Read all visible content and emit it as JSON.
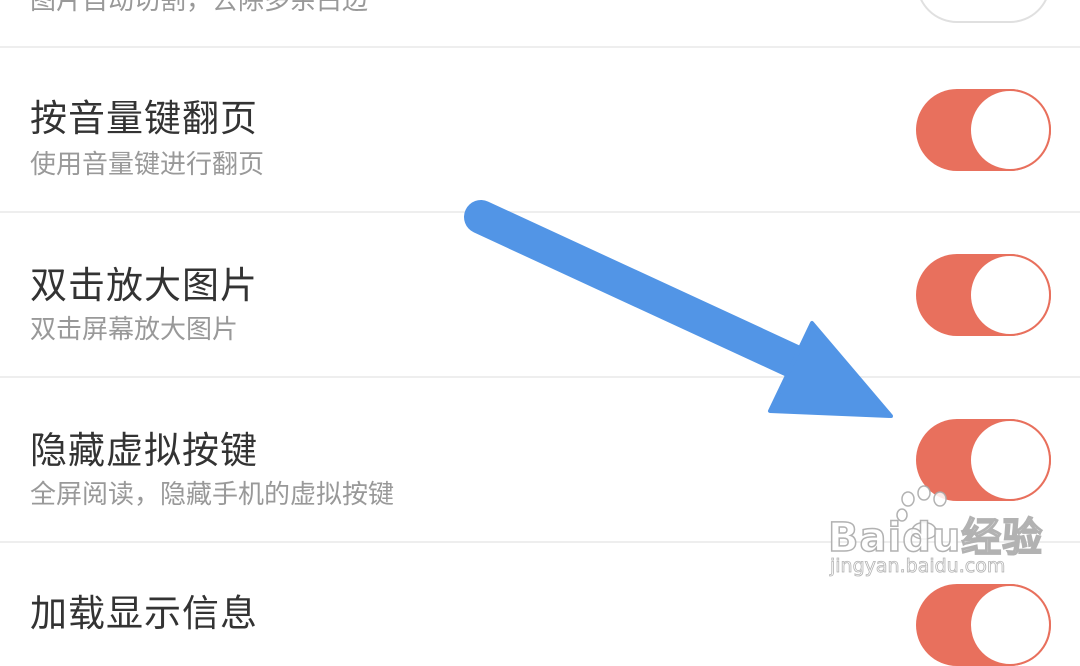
{
  "settings": [
    {
      "title": "",
      "subtitle": "图片自动切割，去除多余白边",
      "enabled": false
    },
    {
      "title": "按音量键翻页",
      "subtitle": "使用音量键进行翻页",
      "enabled": true
    },
    {
      "title": "双击放大图片",
      "subtitle": "双击屏幕放大图片",
      "enabled": true
    },
    {
      "title": "隐藏虚拟按键",
      "subtitle": "全屏阅读，隐藏手机的虚拟按键",
      "enabled": true
    },
    {
      "title": "加载显示信息",
      "subtitle": "",
      "enabled": true
    }
  ],
  "watermark": {
    "brand": "Baidu经验",
    "url": "jingyan.baidu.com"
  },
  "colors": {
    "toggle_on": "#e8705d",
    "arrow": "#5295e6",
    "title_text": "#333333",
    "subtitle_text": "#999999"
  }
}
